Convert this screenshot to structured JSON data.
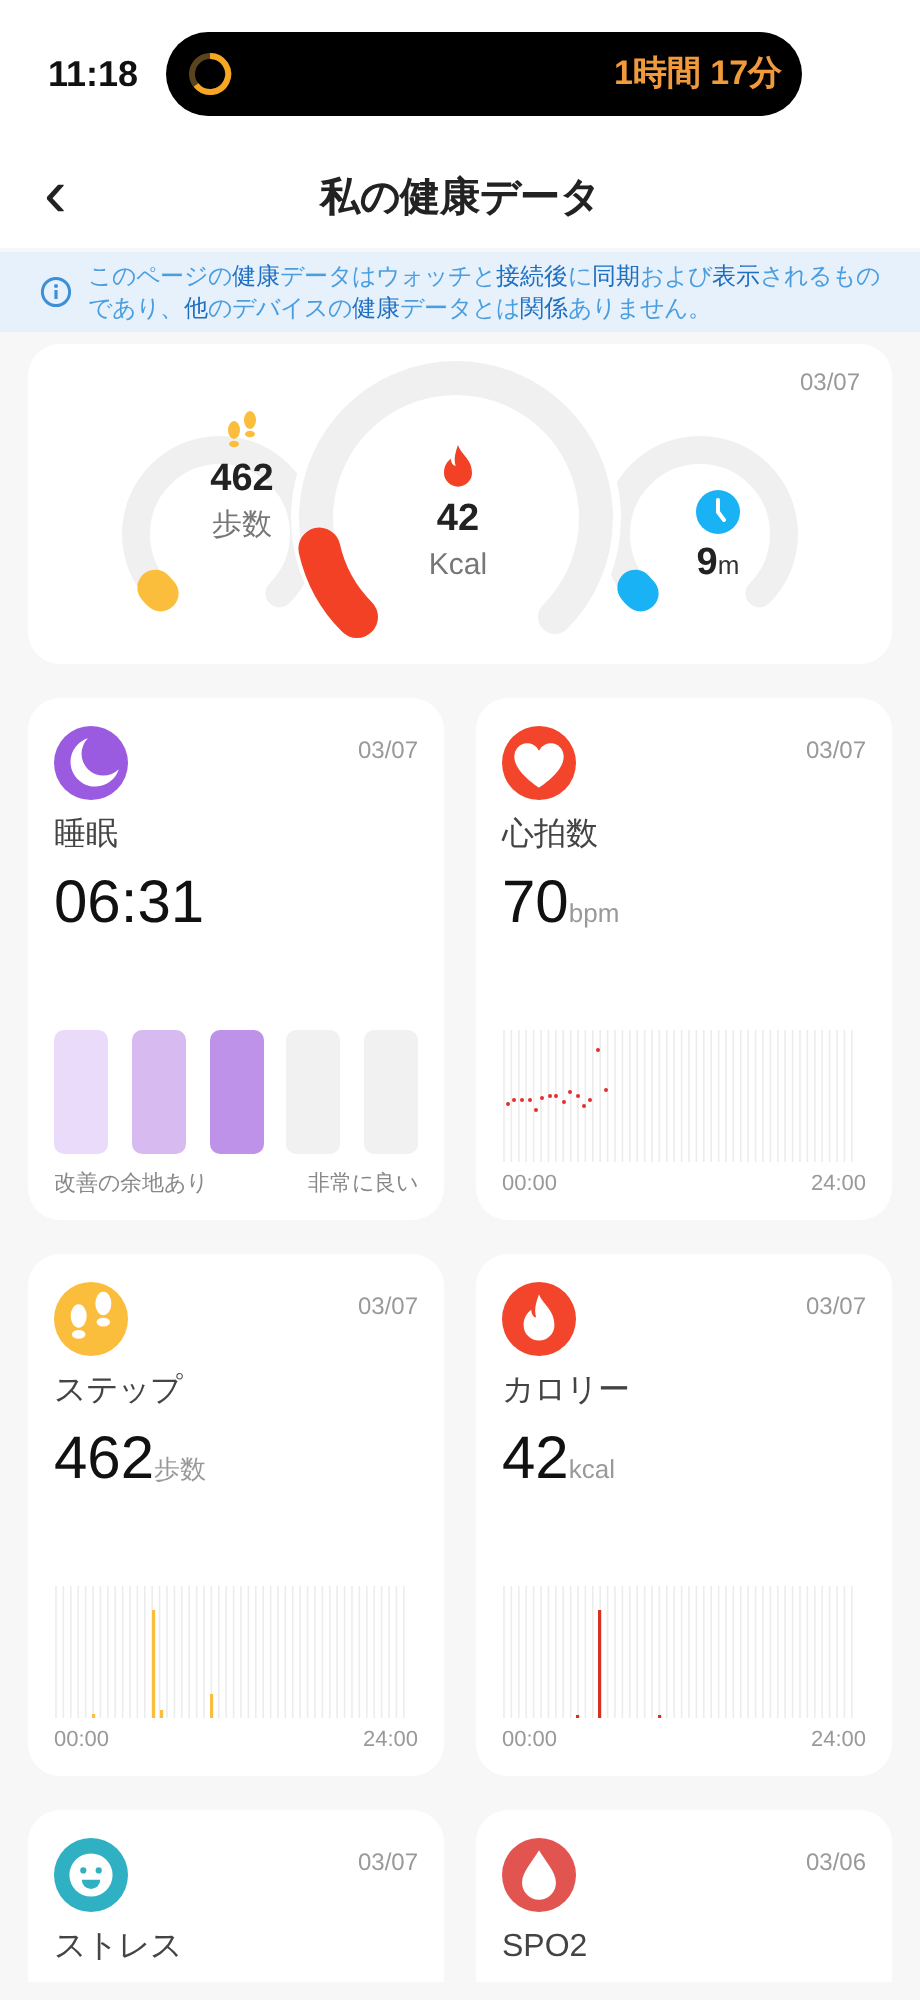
{
  "status_bar": {
    "time": "11:18",
    "activity_timer": "1時間 17分"
  },
  "header": {
    "back": "‹",
    "title": "私の健康データ"
  },
  "notice": {
    "text": "このページの**健康**データはウォッチと**接続後**に**同期**および**表示**されるものであり、**他**のデバイスの**健康**データとは**関係**ありません。"
  },
  "summary": {
    "date": "03/07",
    "gauges": [
      {
        "kind": "steps",
        "value": "462",
        "unit": "歩数"
      },
      {
        "kind": "calories",
        "value": "42",
        "unit": "Kcal"
      },
      {
        "kind": "time",
        "value": "9",
        "unit": "m"
      }
    ]
  },
  "cards": [
    {
      "kind": "sleep",
      "date": "03/07",
      "title": "睡眠",
      "value": "06:31",
      "segments": [
        {
          "color": "#eadbfa"
        },
        {
          "color": "#d7baf0"
        },
        {
          "color": "#bf92ea"
        },
        {
          "color": "#f1f1f1"
        },
        {
          "color": "#f1f1f1"
        }
      ],
      "low_label": "改善の余地あり",
      "high_label": "非常に良い"
    },
    {
      "kind": "heart_rate",
      "date": "03/07",
      "title": "心拍数",
      "value": "70",
      "unit": "bpm",
      "start": "00:00",
      "end": "24:00"
    },
    {
      "kind": "steps",
      "date": "03/07",
      "title": "ステップ",
      "value": "462",
      "unit": "歩数",
      "start": "00:00",
      "end": "24:00"
    },
    {
      "kind": "calories",
      "date": "03/07",
      "title": "カロリー",
      "value": "42",
      "unit": "kcal",
      "start": "00:00",
      "end": "24:00"
    },
    {
      "kind": "stress",
      "date": "03/07",
      "title": "ストレス"
    },
    {
      "kind": "spo2",
      "date": "03/06",
      "title": "SPO2"
    }
  ]
}
